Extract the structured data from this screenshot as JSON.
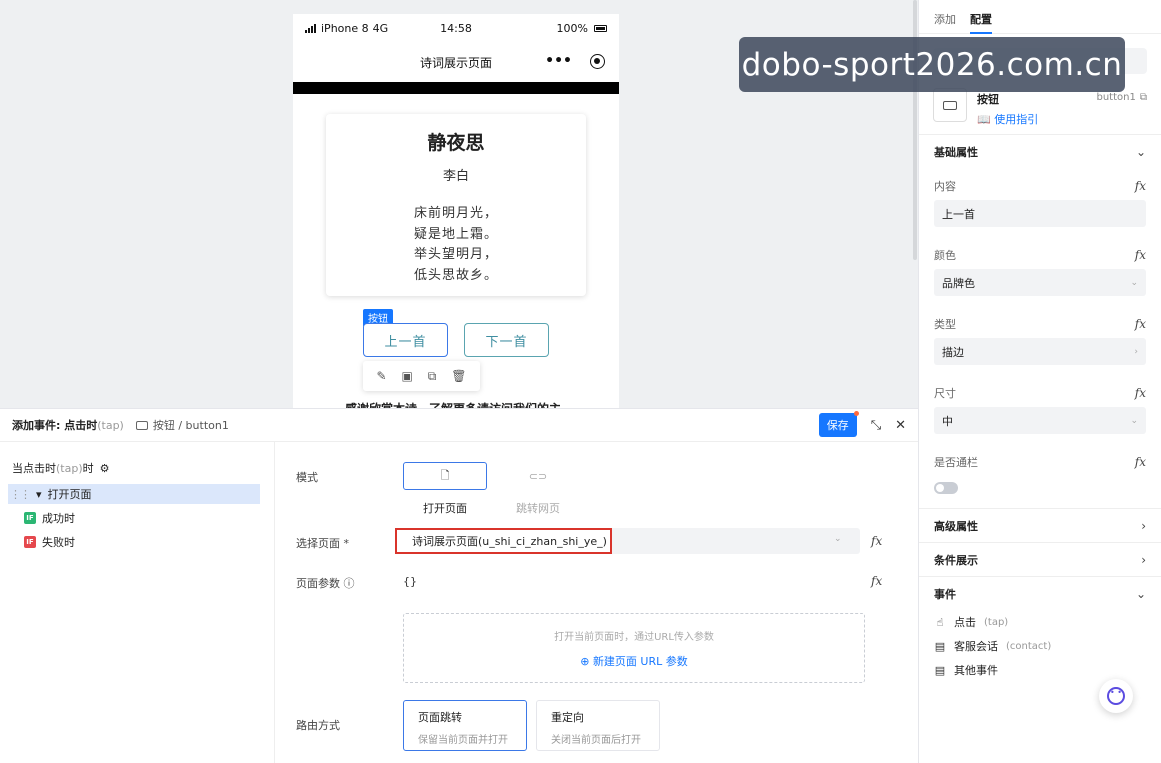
{
  "phone": {
    "carrier": "iPhone 8",
    "network": "4G",
    "time": "14:58",
    "battery": "100%",
    "nav_title": "诗词展示页面",
    "poem": {
      "title": "静夜思",
      "author": "李白",
      "lines": [
        "床前明月光，",
        "疑是地上霜。",
        "举头望明月，",
        "低头思故乡。"
      ]
    },
    "button_tag": "按钮",
    "prev_button": "上一首",
    "next_button": "下一首",
    "bottom_text": "感谢欣赏本诗，了解更多请访问我们的主"
  },
  "config": {
    "tabs": [
      "添加",
      "配置"
    ],
    "component_name": "按钮",
    "component_guide": "使用指引",
    "component_id": "button1",
    "basic_section": "基础属性",
    "props": {
      "content": {
        "label": "内容",
        "value": "上一首"
      },
      "color": {
        "label": "颜色",
        "value": "品牌色"
      },
      "type": {
        "label": "类型",
        "value": "描边"
      },
      "size": {
        "label": "尺寸",
        "value": "中"
      },
      "disabled": {
        "label": "是否通栏"
      }
    },
    "advanced_section": "高级属性",
    "conditional_section": "条件展示",
    "events_section": "事件",
    "events": [
      {
        "label": "点击",
        "sub": "(tap)",
        "icon": "tap-icon"
      },
      {
        "label": "客服会话",
        "sub": "(contact)",
        "icon": "calendar-icon"
      },
      {
        "label": "其他事件",
        "sub": "",
        "icon": "calendar-icon"
      }
    ],
    "fx_label": "fx"
  },
  "event_panel": {
    "title": "添加事件: 点击时",
    "title_sub": "(tap)",
    "component_path": "按钮 / button1",
    "save_label": "保存",
    "tree_root": "当点击时",
    "tree_root_sub": "(tap)",
    "tree_root_suffix": "时",
    "tree_action": "打开页面",
    "tree_success": "成功时",
    "tree_fail": "失败时",
    "if_badge": "IF",
    "mode_label": "模式",
    "mode_open": "打开页面",
    "mode_jump": "跳转网页",
    "select_page_label": "选择页面 *",
    "select_page_value": "诗词展示页面(u_shi_ci_zhan_shi_ye_)",
    "page_params_label": "页面参数",
    "page_params_value": "{}",
    "params_hint": "打开当前页面时，通过URL传入参数",
    "params_add": "新建页面 URL 参数",
    "route_label": "路由方式",
    "route_push_title": "页面跳转",
    "route_push_desc": "保留当前页面并打开",
    "route_redirect_title": "重定向",
    "route_redirect_desc": "关闭当前页面后打开"
  },
  "watermark": "dobo-sport2026.com.cn",
  "colors": {
    "accent": "#1677ff",
    "highlight_red": "#d9342b",
    "selection_bg": "#dbe7fb",
    "button_teal": "#3f8ea1"
  }
}
